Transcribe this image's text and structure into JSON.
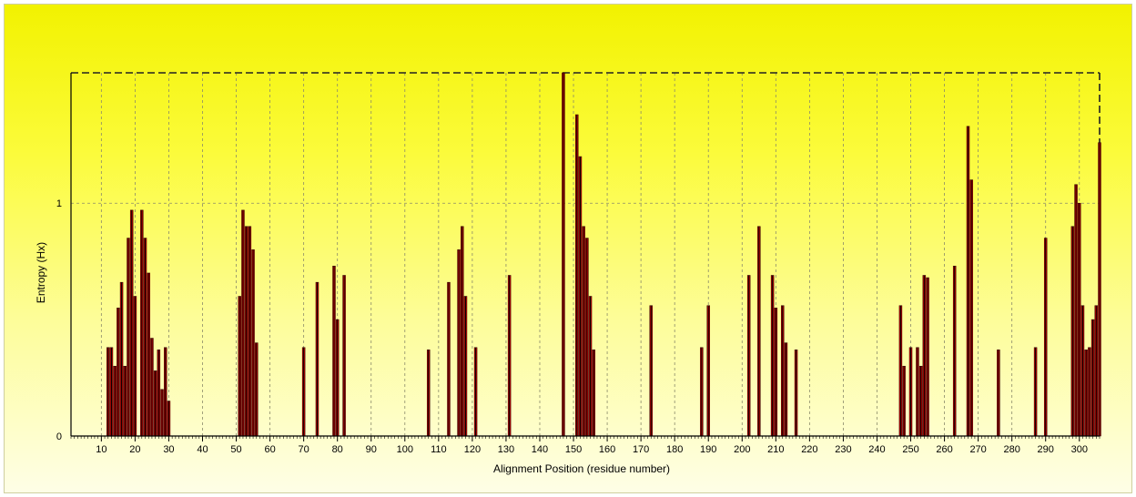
{
  "chart_data": {
    "type": "bar",
    "xlabel": "Alignment Position (residue number)",
    "ylabel": "Entropy (Hx)",
    "x_ticks": [
      10,
      20,
      30,
      40,
      50,
      60,
      70,
      80,
      90,
      100,
      110,
      120,
      130,
      140,
      150,
      160,
      170,
      180,
      190,
      200,
      210,
      220,
      230,
      240,
      250,
      260,
      270,
      280,
      290,
      300
    ],
    "y_ticks": [
      0,
      1
    ],
    "xlim": [
      1,
      306
    ],
    "ylim": [
      0,
      1.56
    ],
    "grid": true,
    "bar_color": "#d10000",
    "points": [
      {
        "x": 12,
        "y": 0.38
      },
      {
        "x": 13,
        "y": 0.38
      },
      {
        "x": 14,
        "y": 0.3
      },
      {
        "x": 15,
        "y": 0.55
      },
      {
        "x": 16,
        "y": 0.66
      },
      {
        "x": 17,
        "y": 0.3
      },
      {
        "x": 18,
        "y": 0.85
      },
      {
        "x": 19,
        "y": 0.97
      },
      {
        "x": 20,
        "y": 0.6
      },
      {
        "x": 22,
        "y": 0.97
      },
      {
        "x": 23,
        "y": 0.85
      },
      {
        "x": 24,
        "y": 0.7
      },
      {
        "x": 25,
        "y": 0.42
      },
      {
        "x": 26,
        "y": 0.28
      },
      {
        "x": 27,
        "y": 0.37
      },
      {
        "x": 28,
        "y": 0.2
      },
      {
        "x": 29,
        "y": 0.38
      },
      {
        "x": 30,
        "y": 0.15
      },
      {
        "x": 51,
        "y": 0.6
      },
      {
        "x": 52,
        "y": 0.97
      },
      {
        "x": 53,
        "y": 0.9
      },
      {
        "x": 54,
        "y": 0.9
      },
      {
        "x": 55,
        "y": 0.8
      },
      {
        "x": 56,
        "y": 0.4
      },
      {
        "x": 70,
        "y": 0.38
      },
      {
        "x": 74,
        "y": 0.66
      },
      {
        "x": 79,
        "y": 0.73
      },
      {
        "x": 80,
        "y": 0.5
      },
      {
        "x": 82,
        "y": 0.69
      },
      {
        "x": 107,
        "y": 0.37
      },
      {
        "x": 113,
        "y": 0.66
      },
      {
        "x": 116,
        "y": 0.8
      },
      {
        "x": 117,
        "y": 0.9
      },
      {
        "x": 118,
        "y": 0.6
      },
      {
        "x": 121,
        "y": 0.38
      },
      {
        "x": 131,
        "y": 0.69
      },
      {
        "x": 147,
        "y": 1.56
      },
      {
        "x": 151,
        "y": 1.38
      },
      {
        "x": 152,
        "y": 1.2
      },
      {
        "x": 153,
        "y": 0.9
      },
      {
        "x": 154,
        "y": 0.85
      },
      {
        "x": 155,
        "y": 0.6
      },
      {
        "x": 156,
        "y": 0.37
      },
      {
        "x": 173,
        "y": 0.56
      },
      {
        "x": 188,
        "y": 0.38
      },
      {
        "x": 190,
        "y": 0.56
      },
      {
        "x": 202,
        "y": 0.69
      },
      {
        "x": 205,
        "y": 0.9
      },
      {
        "x": 209,
        "y": 0.69
      },
      {
        "x": 210,
        "y": 0.55
      },
      {
        "x": 212,
        "y": 0.56
      },
      {
        "x": 213,
        "y": 0.4
      },
      {
        "x": 216,
        "y": 0.37
      },
      {
        "x": 247,
        "y": 0.56
      },
      {
        "x": 248,
        "y": 0.3
      },
      {
        "x": 250,
        "y": 0.38
      },
      {
        "x": 252,
        "y": 0.38
      },
      {
        "x": 253,
        "y": 0.3
      },
      {
        "x": 254,
        "y": 0.69
      },
      {
        "x": 255,
        "y": 0.68
      },
      {
        "x": 263,
        "y": 0.73
      },
      {
        "x": 267,
        "y": 1.33
      },
      {
        "x": 268,
        "y": 1.1
      },
      {
        "x": 276,
        "y": 0.37
      },
      {
        "x": 287,
        "y": 0.38
      },
      {
        "x": 290,
        "y": 0.85
      },
      {
        "x": 298,
        "y": 0.9
      },
      {
        "x": 299,
        "y": 1.08
      },
      {
        "x": 300,
        "y": 1.0
      },
      {
        "x": 301,
        "y": 0.56
      },
      {
        "x": 302,
        "y": 0.37
      },
      {
        "x": 303,
        "y": 0.38
      },
      {
        "x": 304,
        "y": 0.5
      },
      {
        "x": 305,
        "y": 0.56
      },
      {
        "x": 306,
        "y": 1.26
      }
    ]
  }
}
